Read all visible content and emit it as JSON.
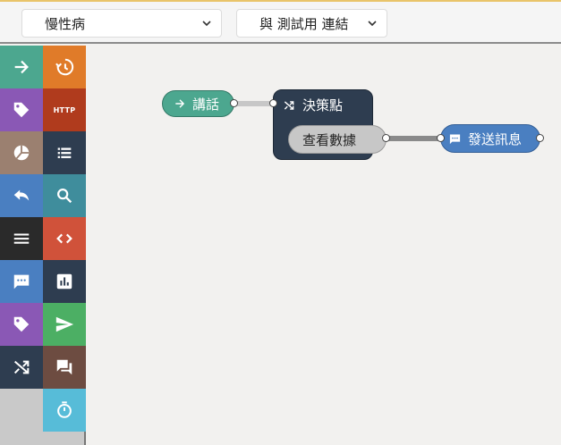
{
  "toolbar": {
    "condition_select": "慢性病",
    "connect_select": "與 測試用 連結"
  },
  "palette": {
    "tiles": [
      {
        "icon": "arrow-right-icon",
        "color": "#4ca78f"
      },
      {
        "icon": "history-icon",
        "color": "#e07b29"
      },
      {
        "icon": "tag-icon",
        "color": "#8a58b5"
      },
      {
        "icon": "http-icon",
        "label": "HTTP",
        "color": "#b03b1d"
      },
      {
        "icon": "pie-chart-icon",
        "color": "#9b8070"
      },
      {
        "icon": "list-icon",
        "color": "#2e3d50"
      },
      {
        "icon": "reply-icon",
        "color": "#4a7fc1"
      },
      {
        "icon": "search-icon",
        "color": "#3f8d9c"
      },
      {
        "icon": "menu-icon",
        "color": "#2a2a2a"
      },
      {
        "icon": "code-icon",
        "color": "#d0523a"
      },
      {
        "icon": "chat-icon",
        "color": "#4a7fc1"
      },
      {
        "icon": "bar-chart-icon",
        "color": "#2e3d50"
      },
      {
        "icon": "tag-icon",
        "color": "#8a58b5"
      },
      {
        "icon": "send-icon",
        "color": "#4caf64"
      },
      {
        "icon": "shuffle-icon",
        "color": "#2e3d50"
      },
      {
        "icon": "forum-icon",
        "color": "#6d4c41"
      },
      {
        "icon": "timer-icon",
        "color": "#57bcd8"
      }
    ]
  },
  "flow": {
    "speak_node": {
      "label": "講話",
      "icon": "arrow-right-icon",
      "color": "#4ca78f"
    },
    "decision_node": {
      "label": "決策點",
      "icon": "shuffle-icon",
      "option": "查看數據",
      "color": "#2e3d50"
    },
    "send_node": {
      "label": "發送訊息",
      "icon": "chat-icon",
      "color": "#4a7fc1"
    }
  }
}
